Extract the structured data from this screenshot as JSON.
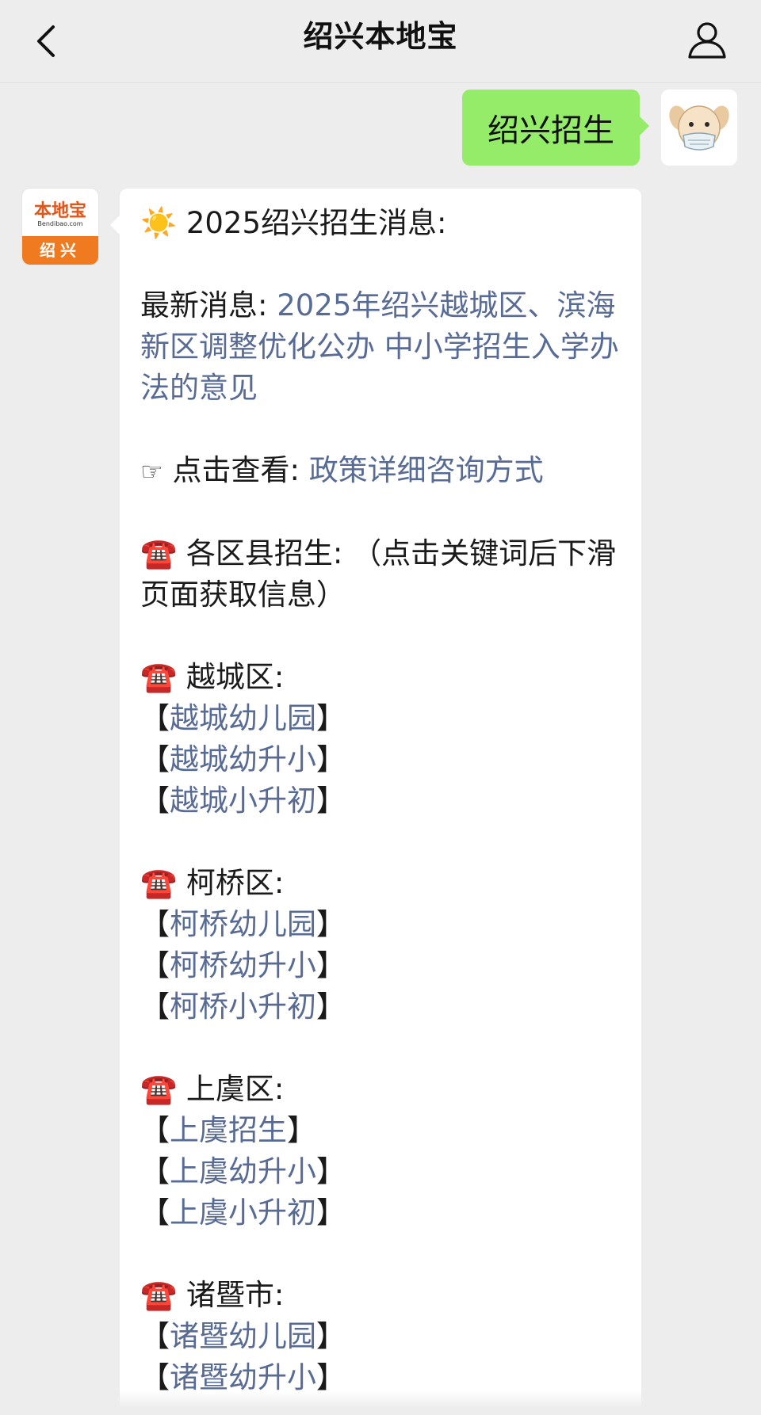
{
  "header": {
    "title": "绍兴本地宝"
  },
  "outgoing": {
    "text": "绍兴招生"
  },
  "account_avatar": {
    "brand": "本地宝",
    "domain": "Bendibao.com",
    "city": "绍兴"
  },
  "message": {
    "intro": {
      "icon": "☀️",
      "text": "2025绍兴招生消息:"
    },
    "latest": {
      "label": "最新消息:",
      "link": "2025年绍兴越城区、滨海新区调整优化公办 中小学招生入学办法的意见"
    },
    "view": {
      "icon": "☞",
      "label": "点击查看:",
      "link": "政策详细咨询方式"
    },
    "districts_intro": {
      "icon": "☎️",
      "text": "各区县招生: （点击关键词后下滑页面获取信息）"
    },
    "districts": [
      {
        "icon": "☎️",
        "name": "越城区:",
        "links": [
          "越城幼儿园",
          "越城幼升小",
          "越城小升初"
        ]
      },
      {
        "icon": "☎️",
        "name": "柯桥区:",
        "links": [
          "柯桥幼儿园",
          "柯桥幼升小",
          "柯桥小升初"
        ]
      },
      {
        "icon": "☎️",
        "name": "上虞区:",
        "links": [
          "上虞招生",
          "上虞幼升小",
          "上虞小升初"
        ]
      },
      {
        "icon": "☎️",
        "name": "诸暨市:",
        "links": [
          "诸暨幼儿园",
          "诸暨幼升小"
        ]
      }
    ]
  },
  "icons": {
    "back": "chevron-left-icon",
    "profile": "person-outline-icon",
    "sun": "sun-icon",
    "pointer": "pointing-hand-icon",
    "phone": "telephone-icon"
  },
  "colors": {
    "background": "#ededed",
    "outgoing_bubble": "#95ec69",
    "incoming_bubble": "#ffffff",
    "link": "#576b95",
    "brand_orange": "#f07a1f"
  }
}
